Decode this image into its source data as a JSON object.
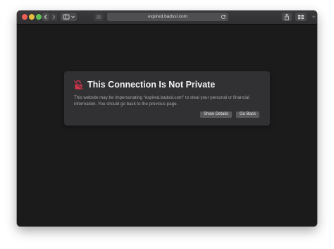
{
  "browser": {
    "address": "expired.badssl.com",
    "new_tab": "+"
  },
  "warning": {
    "title": "This Connection Is Not Private",
    "message": "This website may be impersonating “expired.badssl.com” to steal your personal or financial information. You should go back to the previous page.",
    "show_details_label": "Show Details",
    "go_back_label": "Go Back",
    "icon_color": "#d0344b"
  },
  "colors": {
    "page_background": "#1b1b1c",
    "dialog_background": "#313133",
    "toolbar": "#2f2f31"
  }
}
